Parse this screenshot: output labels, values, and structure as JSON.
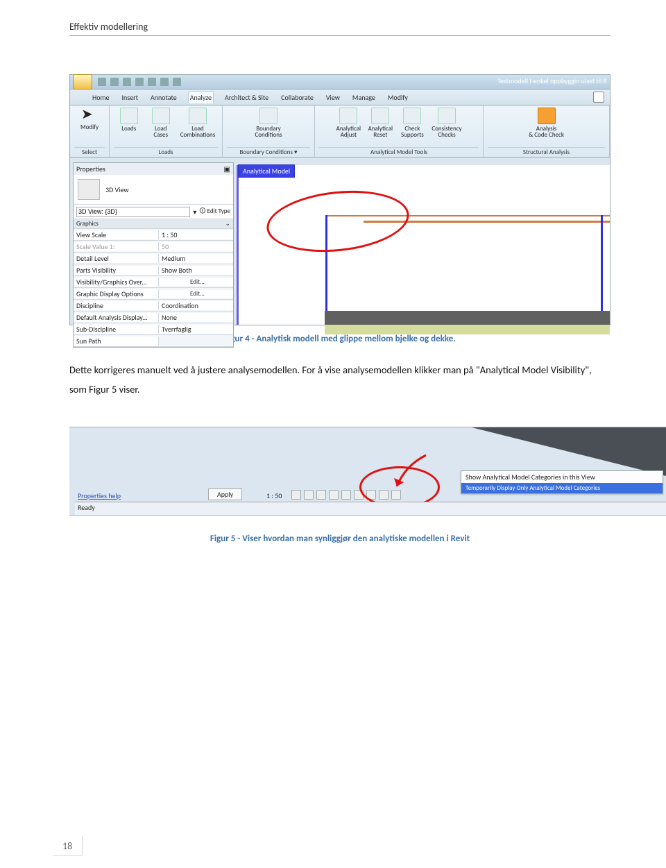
{
  "header": "Effektiv modellering",
  "page_number": "18",
  "caption1": "Figur 4 - Analytisk modell med glippe mellom bjelke og dekke.",
  "paragraph": "Dette korrigeres manuelt ved å justere analysemodellen. For å vise analysemodellen klikker man på \"Analytical Model Visibility\", som Figur 5 viser.",
  "caption2": "Figur 5 - Viser hvordan man synliggjør den analytiske modellen i Revit",
  "shot1": {
    "window_title": "Testmodell I-enkel oppbyggin ulast til R",
    "tabs": [
      "Home",
      "Insert",
      "Annotate",
      "Analyze",
      "Architect & Site",
      "Collaborate",
      "View",
      "Manage",
      "Modify"
    ],
    "active_tab": "Analyze",
    "panels": [
      {
        "title": "Select",
        "buttons": [
          {
            "lbl": "Modify",
            "icon": "arrow"
          }
        ]
      },
      {
        "title": "Loads",
        "buttons": [
          {
            "lbl": "Loads"
          },
          {
            "lbl": "Load\nCases"
          },
          {
            "lbl": "Load\nCombinations"
          }
        ]
      },
      {
        "title": "Boundary Conditions ▾",
        "buttons": [
          {
            "lbl": "Boundary\nConditions"
          }
        ]
      },
      {
        "title": "Analytical Model Tools",
        "buttons": [
          {
            "lbl": "Analytical\nAdjust"
          },
          {
            "lbl": "Analytical\nReset"
          },
          {
            "lbl": "Check\nSupports"
          },
          {
            "lbl": "Consistency\nChecks"
          }
        ]
      },
      {
        "title": "Structural Analysis",
        "buttons": [
          {
            "lbl": "Analysis\n& Code Check"
          }
        ]
      }
    ],
    "view_tab_label": "Analytical Model",
    "properties": {
      "title": "Properties",
      "view_type": "3D View",
      "selector": "3D View: {3D}",
      "edit_type": "Edit Type",
      "category": "Graphics",
      "rows": [
        {
          "k": "View Scale",
          "v": "1 : 50"
        },
        {
          "k": "Scale Value    1:",
          "v": "50",
          "dim": true
        },
        {
          "k": "Detail Level",
          "v": "Medium"
        },
        {
          "k": "Parts Visibility",
          "v": "Show Both"
        },
        {
          "k": "Visibility/Graphics Over...",
          "v": "Edit...",
          "btn": true
        },
        {
          "k": "Graphic Display Options",
          "v": "Edit...",
          "btn": true
        },
        {
          "k": "Discipline",
          "v": "Coordination"
        },
        {
          "k": "Default Analysis Display...",
          "v": "None"
        },
        {
          "k": "Sub-Discipline",
          "v": "Tverrfaglig"
        },
        {
          "k": "Sun Path",
          "v": ""
        }
      ]
    }
  },
  "shot2": {
    "menu": [
      "Show Analytical Model Categories in this View",
      "Temporarily Display Only Analytical Model Categories"
    ],
    "properties_help": "Properties help",
    "apply": "Apply",
    "scale": "1 : 50",
    "status": "Ready"
  }
}
